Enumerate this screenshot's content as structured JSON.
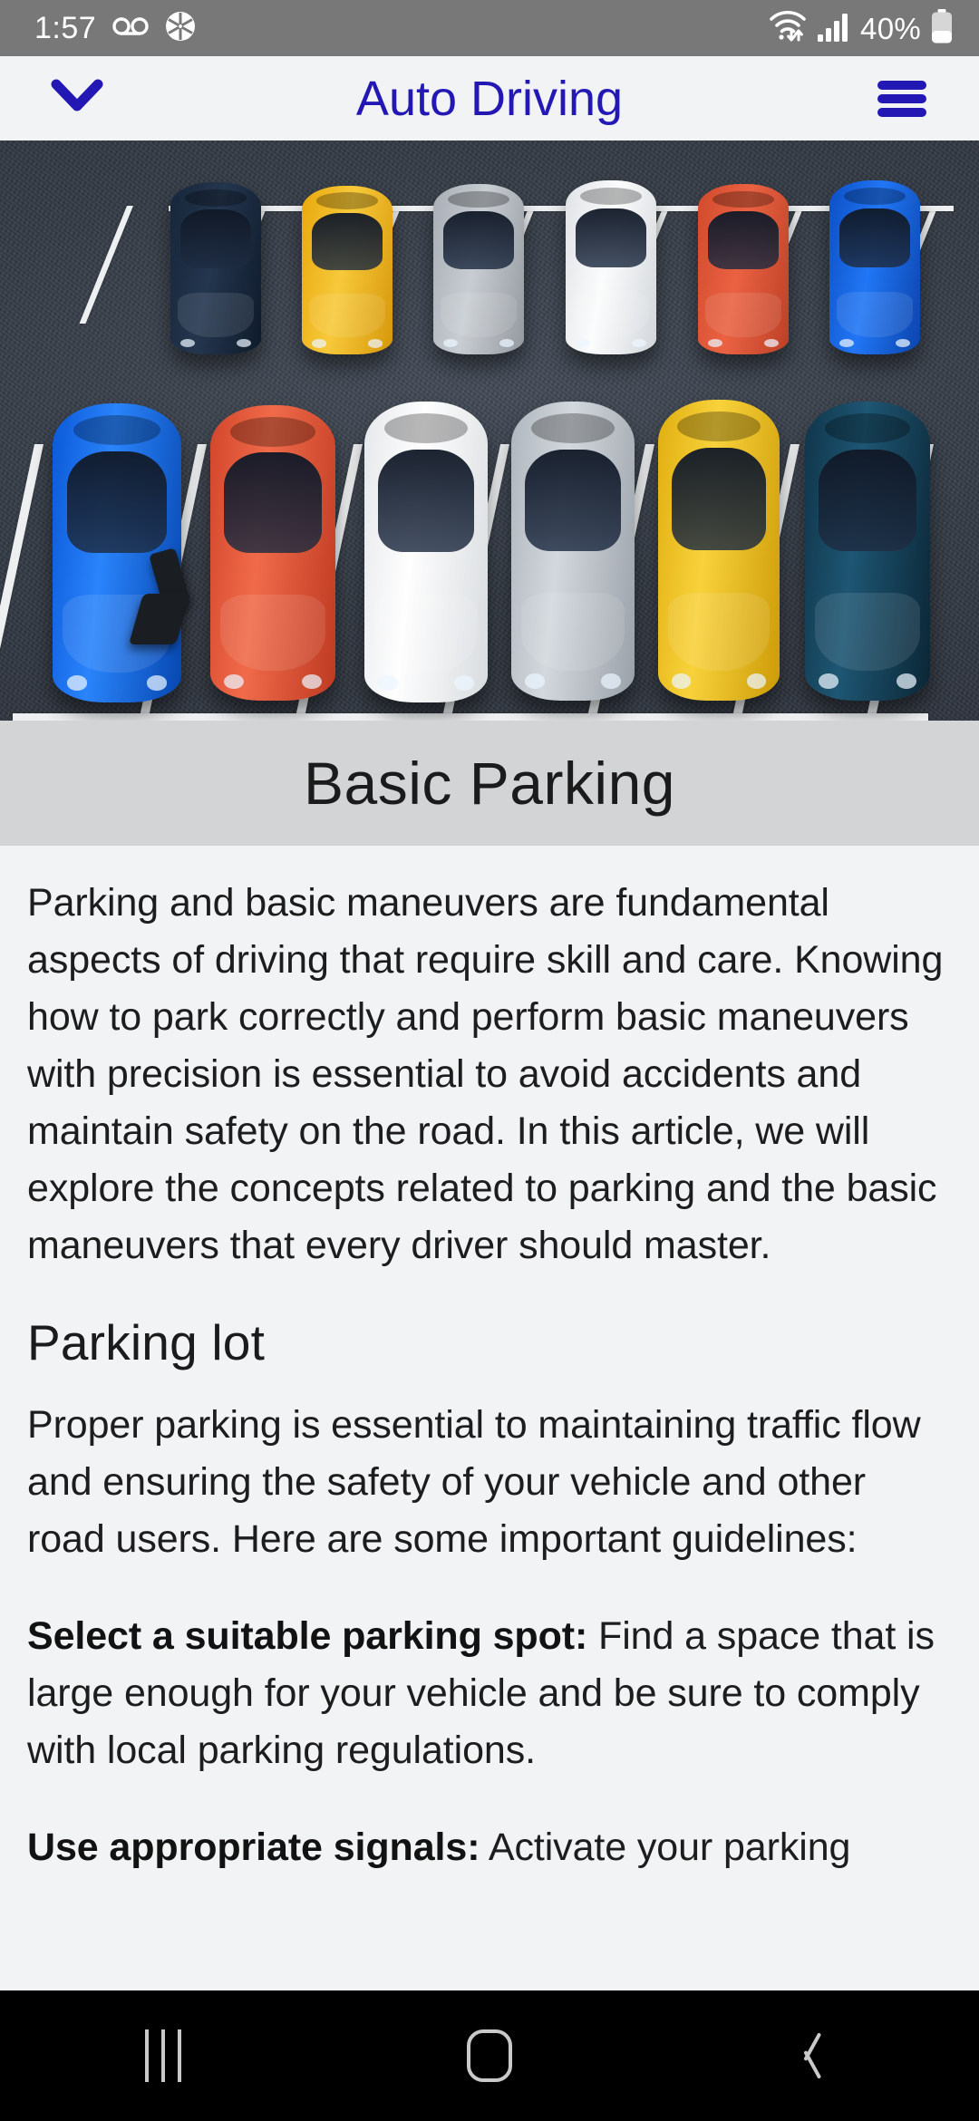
{
  "status_bar": {
    "time": "1:57",
    "battery_percent": "40%",
    "battery_level": 40,
    "left_icons": [
      "voicemail-icon",
      "camera-aperture-icon"
    ],
    "right_icons": [
      "wifi-icon",
      "cellular-signal-icon",
      "battery-icon"
    ],
    "signal_bars": 3,
    "background_color": "#787878",
    "foreground_color": "#FFFFFF"
  },
  "app_bar": {
    "title": "Auto Driving",
    "back_icon": "chevron-down-icon",
    "menu_icon": "hamburger-menu-icon",
    "accent_color": "#2418B4",
    "background_color": "#F1F3F4"
  },
  "hero": {
    "alt": "Aerial view of cars parked in marked parking lot stalls",
    "top_row_car_colors": [
      "#1C2B3E",
      "#F2B81D",
      "#B9BEC4",
      "#F2F3F4",
      "#E0563A",
      "#1668E3"
    ],
    "bottom_row_car_colors": [
      "#1272F0",
      "#E8563B",
      "#F4F5F6",
      "#C3C9CE",
      "#F2C224",
      "#17435C"
    ],
    "asphalt_color": "#343B45",
    "line_color": "#EDEFF0"
  },
  "page_title": {
    "text": "Basic Parking",
    "band_color": "#D2D4D6",
    "text_color": "#1B1B1B"
  },
  "article": {
    "intro": "Parking and basic maneuvers are fundamental aspects of driving that require skill and care. Knowing how to park correctly and perform basic maneuvers with precision is essential to avoid accidents and maintain safety on the road. In this article, we will explore the concepts related to parking and the basic maneuvers that every driver should master.",
    "section_heading": "Parking lot",
    "section_body": "Proper parking is essential to maintaining traffic flow and ensuring the safety of your vehicle and other road users. Here are some important guidelines:",
    "tips": [
      {
        "label": "Select a suitable parking spot:",
        "text": " Find a space that is large enough for your vehicle and be sure to comply with local parking regulations."
      },
      {
        "label": "Use appropriate signals:",
        "text": " Activate your parking"
      }
    ],
    "background_color": "#F1F3F4",
    "text_color": "#1D1D1D"
  },
  "nav_bar": {
    "items": [
      {
        "name": "recents-button",
        "icon": "recents-icon"
      },
      {
        "name": "home-button",
        "icon": "home-icon"
      },
      {
        "name": "back-button",
        "icon": "back-chevron-icon"
      }
    ],
    "background_color": "#000000",
    "icon_color": "#C9C9C9"
  }
}
